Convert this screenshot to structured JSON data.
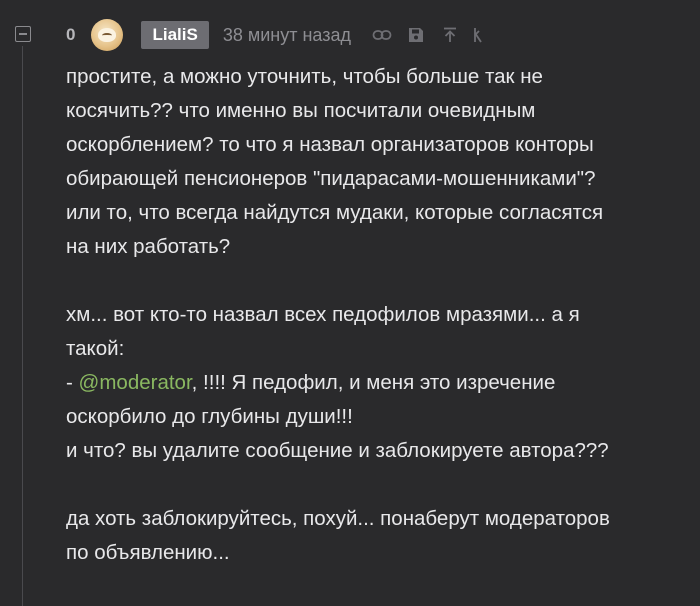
{
  "comment": {
    "rating": "0",
    "username": "LialiS",
    "timestamp": "38 минут назад",
    "icons": [
      "link-icon",
      "save-icon",
      "upload-icon",
      "user-icon"
    ],
    "paragraphs": [
      {
        "lines": [
          "простите, а можно уточнить, чтобы больше так не",
          "косячить?? что именно вы посчитали очевидным",
          "оскорблением? то что я назвал организаторов конторы",
          "обирающей пенсионеров \"пидарасами-мошенниками\"?",
          "или то, что всегда найдутся мудаки, которые согласятся",
          "на них работать?"
        ]
      },
      {
        "line1": "хм... вот кто-то назвал всех педофилов мразями... а я",
        "line2": "такой:",
        "line3_prefix": "- ",
        "mention": "@moderator",
        "line3_suffix": ", !!!! Я педофил, и меня это изречение",
        "line4": "оскорбило до глубины души!!!",
        "line5": "и что? вы удалите сообщение и заблокируете автора???"
      },
      {
        "lines": [
          "да хоть заблокируйтесь, похуй... понаберут модераторов",
          "по объявлению..."
        ]
      }
    ]
  }
}
